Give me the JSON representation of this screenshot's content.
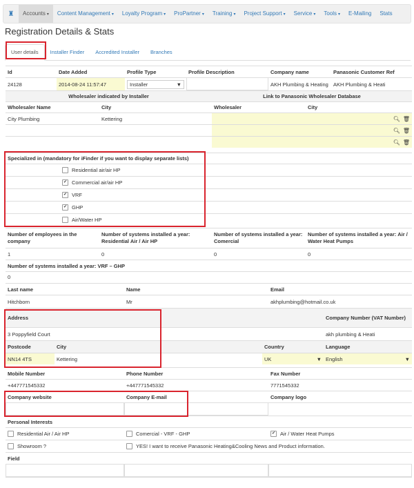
{
  "nav": {
    "items": [
      {
        "label": "Accounts",
        "caret": "▾"
      },
      {
        "label": "Content Management",
        "caret": "▾"
      },
      {
        "label": "Loyalty Program",
        "caret": "▾"
      },
      {
        "label": "ProPartner",
        "caret": "▾"
      },
      {
        "label": "Training",
        "caret": "▾"
      },
      {
        "label": "Project Support",
        "caret": "▾"
      },
      {
        "label": "Service",
        "caret": "▾"
      },
      {
        "label": "Tools",
        "caret": "▾"
      },
      {
        "label": "E-Mailing",
        "caret": ""
      },
      {
        "label": "Stats",
        "caret": ""
      }
    ]
  },
  "page_title": "Registration Details & Stats",
  "tabs": [
    "User details",
    "Installer Finder",
    "Accredited Installer",
    "Branches"
  ],
  "profile": {
    "headers": [
      "Id",
      "Date Added",
      "Profile Type",
      "Profile Description",
      "Company name",
      "Panasonic Customer Ref"
    ],
    "values": {
      "id": "24128",
      "date_added": "2014-08-24 11:57:47",
      "profile_type": "Installer",
      "profile_description": "",
      "company_name": "AKH Plumbing & Heating",
      "customer_ref": "AKH Plumbing & Heati"
    }
  },
  "wholesaler": {
    "left_title": "Wholesaler indicated by Installer",
    "right_title": "Link to Panasonic Wholesaler Database",
    "col_name": "Wholesaler Name",
    "col_city": "City",
    "col_wholesaler": "Wholesaler",
    "col_city2": "City",
    "rows": [
      {
        "name": "City Plumbing",
        "city": "Kettering"
      },
      {
        "name": "",
        "city": ""
      },
      {
        "name": "",
        "city": ""
      }
    ]
  },
  "specialized": {
    "title": "Specialized in (mandatory for iFinder if you want to display separate lists)",
    "options": [
      {
        "label": "Residential air/air HP",
        "checked": false
      },
      {
        "label": "Commercial air/air HP",
        "checked": true
      },
      {
        "label": "VRF",
        "checked": true
      },
      {
        "label": "GHP",
        "checked": true
      },
      {
        "label": "Air/Water HP",
        "checked": false
      }
    ]
  },
  "employees": {
    "h1": "Number of employees in the company",
    "h2": "Number of systems installed a year: Residential Air / Air HP",
    "h3": "Number of systems installed a year: Comercial",
    "h4": "Number of systems installed a year: Air / Water Heat Pumps",
    "v1": "1",
    "v2": "0",
    "v3": "0",
    "v4": "0",
    "h5": "Number of systems installed a year: VRF – GHP",
    "v5": "0"
  },
  "person": {
    "h_last": "Last name",
    "h_name": "Name",
    "h_email": "Email",
    "last": "Hitchborn",
    "name": "Mr",
    "email": "akhplumbing@hotmail.co.uk"
  },
  "address": {
    "h_address": "Address",
    "h_vat": "Company Number (VAT Number)",
    "address": "3 Poppyfield Court",
    "vat": "akh plumbing & Heati",
    "h_postcode": "Postcode",
    "h_city": "City",
    "h_country": "Country",
    "h_language": "Language",
    "postcode": "NN14 4TS",
    "city": "Kettering",
    "country": "UK",
    "language": "English"
  },
  "phones": {
    "h_mobile": "Mobile Number",
    "h_phone": "Phone Number",
    "h_fax": "Fax Number",
    "mobile": "+447771545332",
    "phone": "+447771545332",
    "fax": "7771545332"
  },
  "company": {
    "h_website": "Company website",
    "h_email": "Company E-mail",
    "h_logo": "Company logo"
  },
  "interests": {
    "title": "Personal Interests",
    "row1": [
      {
        "label": "Residential Air / Air HP",
        "checked": false
      },
      {
        "label": "Comercial - VRF - GHP",
        "checked": false
      },
      {
        "label": "Air / Water Heat Pumps",
        "checked": true
      }
    ],
    "row2": [
      {
        "label": "Showroom ?",
        "checked": false
      },
      {
        "label": "YES! I want to receive Panasonic Heating&Cooling News and Product information.",
        "checked": false
      }
    ]
  },
  "field_label": "Field",
  "colors": {
    "link": "#337ab7",
    "highlight": "#d9232d",
    "field_bg": "#fafad2"
  }
}
